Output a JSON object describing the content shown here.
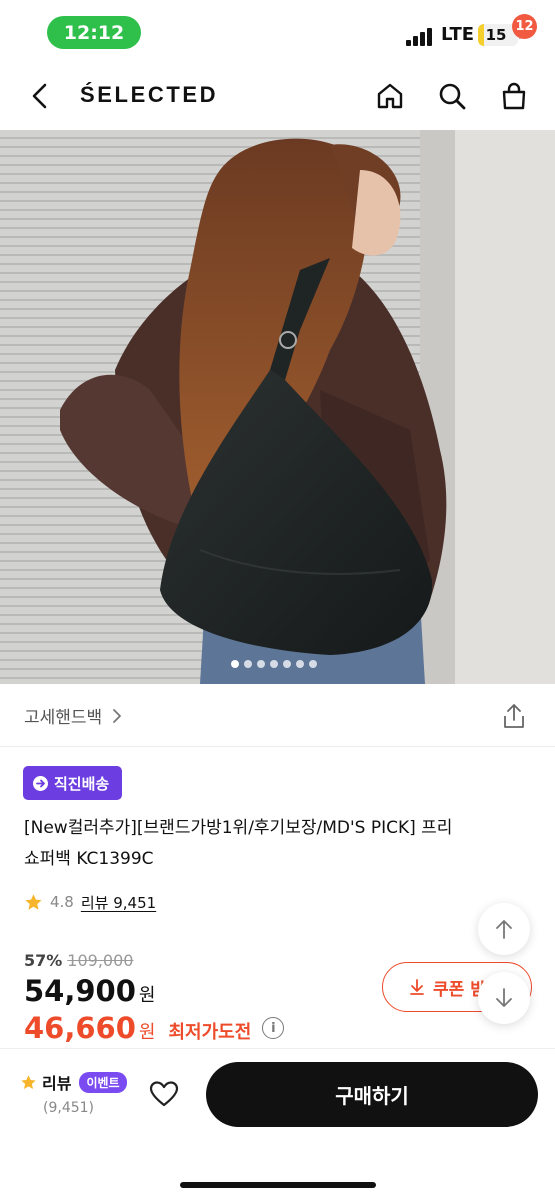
{
  "status_bar": {
    "time": "12:12",
    "network": "LTE",
    "battery": "15",
    "battery_level": 0.15
  },
  "nav": {
    "logo": "ŚELECTED",
    "cart_count": "12",
    "icons": [
      "back-arrow-icon",
      "home-icon",
      "search-icon",
      "cart-bag-icon"
    ]
  },
  "hero": {
    "slide_count": 7,
    "active_index": 0
  },
  "category": {
    "label": "고세핸드백"
  },
  "badge": {
    "label": "직진배송"
  },
  "product": {
    "title_line1": "[New컬러추가][브랜드가방1위/후기보장/MD'S PICK] 프리",
    "title_line2": "쇼퍼백 KC1399C",
    "rating": "4.8",
    "review_label": "리뷰 9,451"
  },
  "pricing": {
    "discount_pct": "57%",
    "original_price": "109,000",
    "price": "54,900",
    "best_price": "46,660",
    "currency": "원",
    "best_price_label": "최저가도전",
    "coupon_label": "쿠폰 받"
  },
  "bottom": {
    "review_label": "리뷰",
    "event_label": "이벤트",
    "review_count": "(9,451)",
    "buy_label": "구매하기"
  },
  "colors": {
    "accent_red": "#ee4b2b",
    "purple": "#6c3de0",
    "time_green": "#2fc04b"
  }
}
